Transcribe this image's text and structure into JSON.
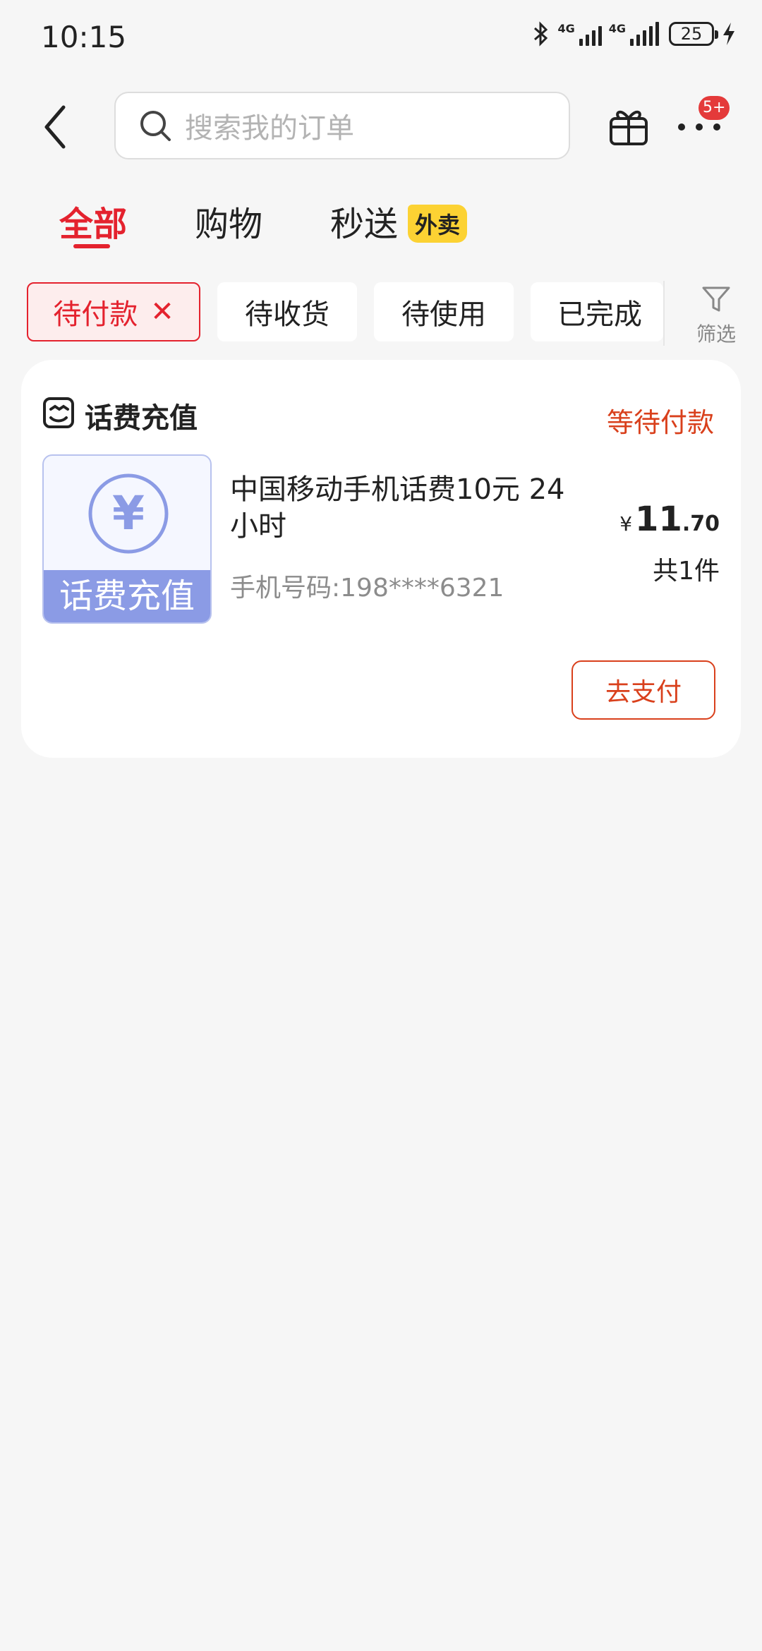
{
  "status_bar": {
    "time": "10:15",
    "network1": "4G",
    "network2": "4G",
    "battery": "25"
  },
  "header": {
    "search_placeholder": "搜索我的订单",
    "more_badge": "5+"
  },
  "tabs": [
    {
      "label": "全部",
      "active": true
    },
    {
      "label": "购物",
      "active": false
    },
    {
      "label": "秒送",
      "active": false,
      "badge": "外卖"
    }
  ],
  "filters": {
    "chips": [
      {
        "label": "待付款",
        "selected": true
      },
      {
        "label": "待收货",
        "selected": false
      },
      {
        "label": "待使用",
        "selected": false
      },
      {
        "label": "已完成",
        "selected": false
      }
    ],
    "filter_label": "筛选"
  },
  "order": {
    "shop_name": "话费充值",
    "status": "等待付款",
    "image_caption": "话费充值",
    "image_symbol": "¥",
    "product_title": "中国移动手机话费10元 24小时",
    "phone": "手机号码:198****6321",
    "price_currency": "¥",
    "price_integer": "11",
    "price_decimal": ".70",
    "quantity": "共1件",
    "pay_button": "去支付"
  },
  "colors": {
    "accent_red": "#e4222e",
    "status_orange": "#d9401c",
    "badge_yellow": "#fcd233",
    "image_blue": "#8b9be5"
  }
}
